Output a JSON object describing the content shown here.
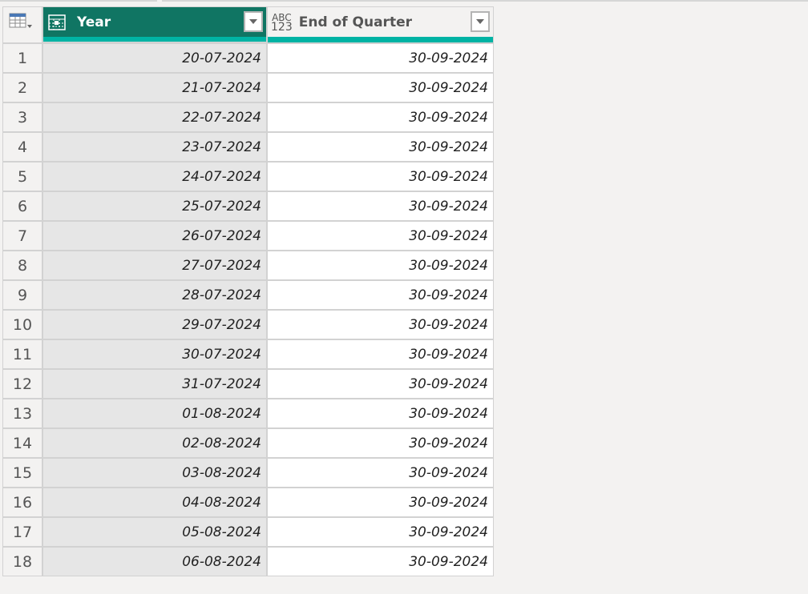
{
  "table_menu_icon": "table-icon",
  "columns": [
    {
      "name": "Year",
      "type_icon": "table-column-icon",
      "selected": true,
      "accent": "#107563"
    },
    {
      "name": "End of Quarter",
      "type_icon": "any-type-icon",
      "type_label_top": "ABC",
      "type_label_bottom": "123",
      "selected": false
    }
  ],
  "quality_bar_color": "#00b3a4",
  "rows": [
    {
      "n": "1",
      "year": "20-07-2024",
      "eoq": "30-09-2024"
    },
    {
      "n": "2",
      "year": "21-07-2024",
      "eoq": "30-09-2024"
    },
    {
      "n": "3",
      "year": "22-07-2024",
      "eoq": "30-09-2024"
    },
    {
      "n": "4",
      "year": "23-07-2024",
      "eoq": "30-09-2024"
    },
    {
      "n": "5",
      "year": "24-07-2024",
      "eoq": "30-09-2024"
    },
    {
      "n": "6",
      "year": "25-07-2024",
      "eoq": "30-09-2024"
    },
    {
      "n": "7",
      "year": "26-07-2024",
      "eoq": "30-09-2024"
    },
    {
      "n": "8",
      "year": "27-07-2024",
      "eoq": "30-09-2024"
    },
    {
      "n": "9",
      "year": "28-07-2024",
      "eoq": "30-09-2024"
    },
    {
      "n": "10",
      "year": "29-07-2024",
      "eoq": "30-09-2024"
    },
    {
      "n": "11",
      "year": "30-07-2024",
      "eoq": "30-09-2024"
    },
    {
      "n": "12",
      "year": "31-07-2024",
      "eoq": "30-09-2024"
    },
    {
      "n": "13",
      "year": "01-08-2024",
      "eoq": "30-09-2024"
    },
    {
      "n": "14",
      "year": "02-08-2024",
      "eoq": "30-09-2024"
    },
    {
      "n": "15",
      "year": "03-08-2024",
      "eoq": "30-09-2024"
    },
    {
      "n": "16",
      "year": "04-08-2024",
      "eoq": "30-09-2024"
    },
    {
      "n": "17",
      "year": "05-08-2024",
      "eoq": "30-09-2024"
    },
    {
      "n": "18",
      "year": "06-08-2024",
      "eoq": "30-09-2024"
    }
  ]
}
